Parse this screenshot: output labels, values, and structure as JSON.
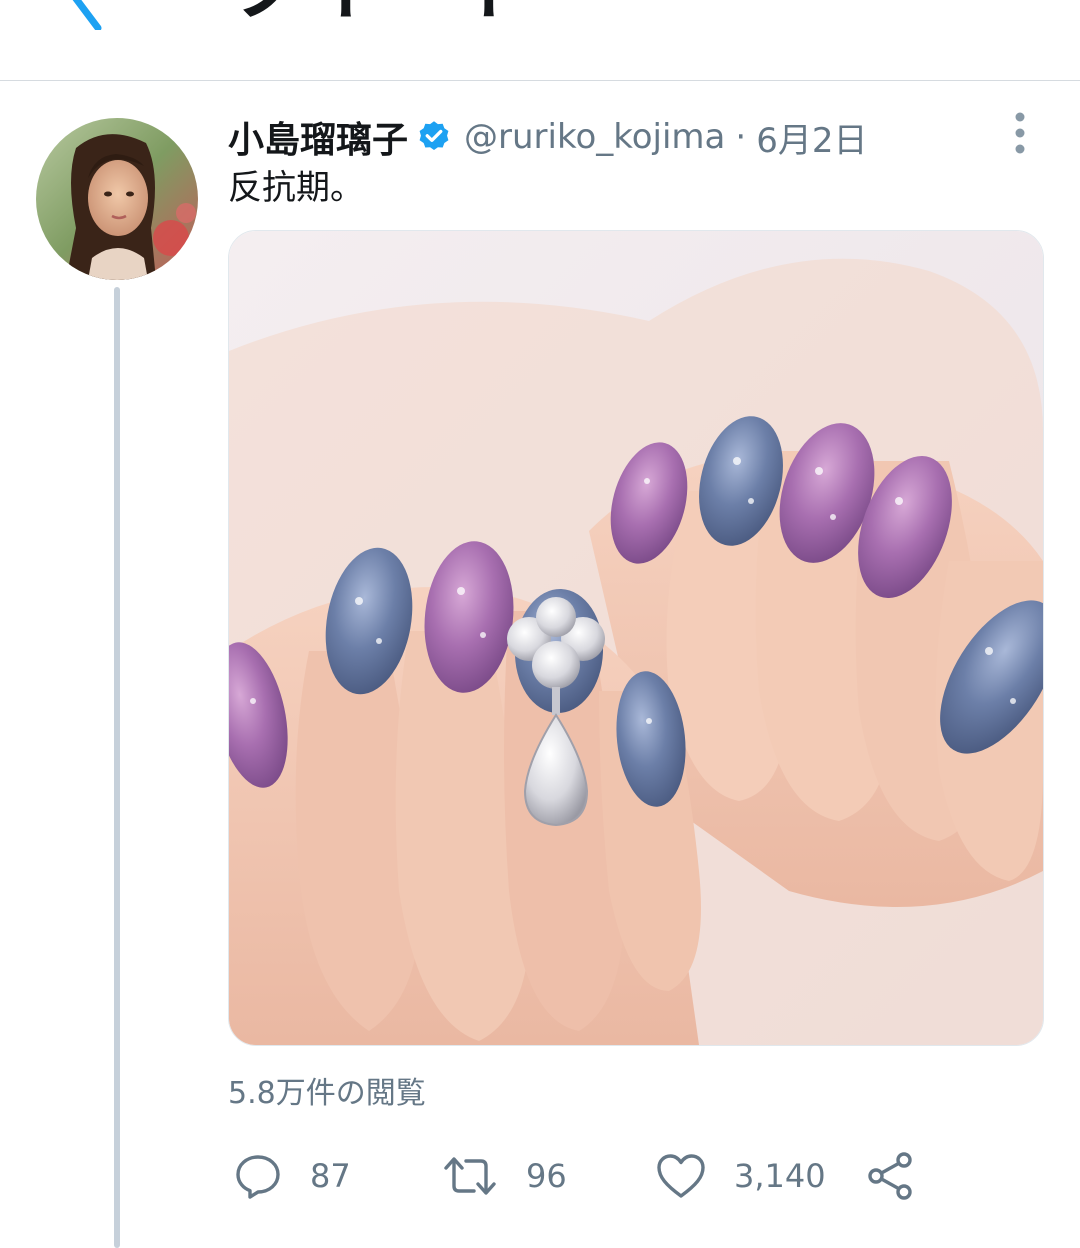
{
  "header": {
    "title": "ツイート",
    "back_icon": "chevron-left-icon"
  },
  "tweet": {
    "avatar_icon": "user-avatar",
    "display_name": "小島瑠璃子",
    "verified_icon": "verified-badge-icon",
    "handle": "@ruriko_kojima",
    "separator": "·",
    "timestamp": "6月2日",
    "more_icon": "more-vertical-icon",
    "text": "反抗期。",
    "media_kind": "video",
    "view_count": "5.8万件の閲覧",
    "actions": {
      "reply": {
        "icon": "reply-icon",
        "count": "87"
      },
      "retweet": {
        "icon": "retweet-icon",
        "count": "96"
      },
      "like": {
        "icon": "heart-icon",
        "count": "3,140"
      },
      "share": {
        "icon": "share-icon"
      }
    }
  },
  "colors": {
    "accent": "#1da1f2",
    "text_primary": "#14171a",
    "text_secondary": "#657786",
    "thread_line": "#c6d0da",
    "divider": "#d6dbe0"
  }
}
